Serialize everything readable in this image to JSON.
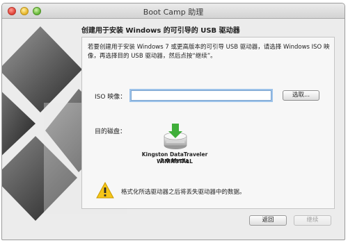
{
  "window": {
    "title": "Boot Camp 助理"
  },
  "header": {
    "title": "创建用于安装 Windows 的可引导的 USB 驱动器"
  },
  "instructions": "若要创建用于安装 Windows 7 或更高版本的可引导 USB 驱动器，请选择 Windows ISO 映像，再选择目的 USB 驱动器，然后点按“继续”。",
  "iso": {
    "label": "ISO 映像：",
    "value": "",
    "choose_label": "选取..."
  },
  "destination": {
    "label": "目的磁盘：",
    "drive_name": "Kingston DataTraveler 2.0 Media",
    "volume_name": "WININSTALL",
    "icon": "usb-drive-icon"
  },
  "warning": {
    "icon": "warning-icon",
    "text": "格式化所选驱动器之后将丢失驱动器中的数据。"
  },
  "footer": {
    "back_label": "返回",
    "continue_label": "继续"
  }
}
